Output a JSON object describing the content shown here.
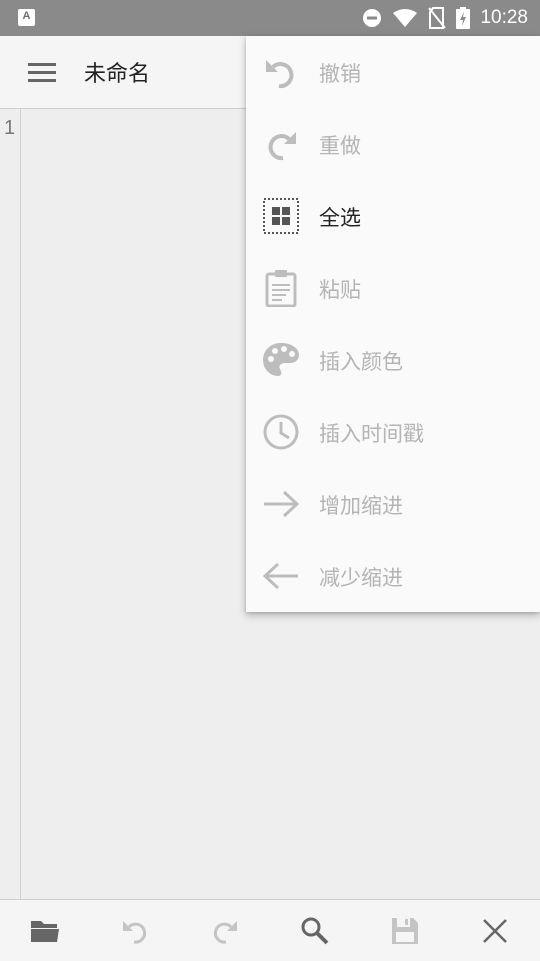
{
  "status_bar": {
    "time": "10:28",
    "notification_icon": "font-a-icon",
    "notification_letter": "A",
    "icons": [
      "do-not-disturb-icon",
      "wifi-icon",
      "no-sim-icon",
      "battery-charging-icon"
    ]
  },
  "app_bar": {
    "menu_icon": "hamburger-menu-icon",
    "title": "未命名"
  },
  "editor": {
    "line_numbers": [
      "1"
    ],
    "text": ""
  },
  "menu": {
    "items": [
      {
        "label": "撤销",
        "icon": "undo-icon",
        "enabled": false
      },
      {
        "label": "重做",
        "icon": "redo-icon",
        "enabled": false
      },
      {
        "label": "全选",
        "icon": "select-all-icon",
        "enabled": true
      },
      {
        "label": "粘贴",
        "icon": "clipboard-icon",
        "enabled": false
      },
      {
        "label": "插入颜色",
        "icon": "palette-icon",
        "enabled": false
      },
      {
        "label": "插入时间戳",
        "icon": "clock-icon",
        "enabled": false
      },
      {
        "label": "增加缩进",
        "icon": "arrow-right-icon",
        "enabled": false
      },
      {
        "label": "减少缩进",
        "icon": "arrow-left-icon",
        "enabled": false
      }
    ]
  },
  "toolbar": {
    "buttons": [
      {
        "icon": "open-folder-icon",
        "enabled": true
      },
      {
        "icon": "undo-icon",
        "enabled": false
      },
      {
        "icon": "redo-icon",
        "enabled": false
      },
      {
        "icon": "search-icon",
        "enabled": true
      },
      {
        "icon": "save-icon",
        "enabled": false
      },
      {
        "icon": "close-icon",
        "enabled": true
      }
    ]
  },
  "colors": {
    "status_bar": "#8a8a8a",
    "app_bar": "#f5f5f5",
    "editor_background": "#eeeeee",
    "menu_background": "#fafafa",
    "text_enabled": "#222222",
    "text_disabled": "#b4b4b4"
  }
}
